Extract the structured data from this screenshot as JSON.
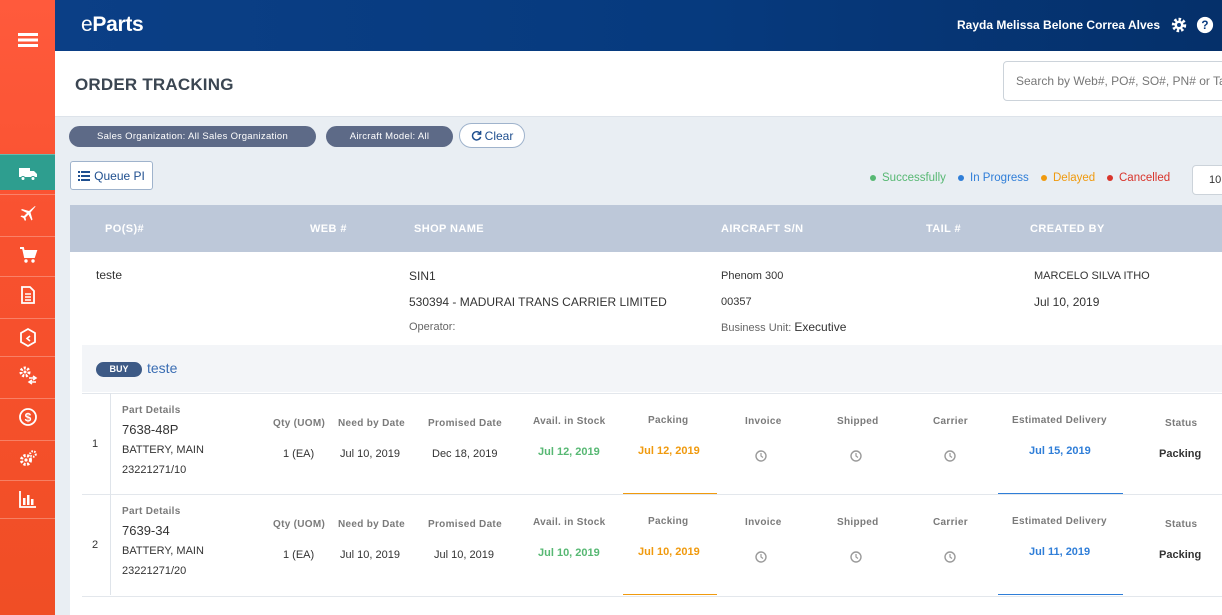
{
  "app": {
    "brand_e": "e",
    "brand_rest": "Parts",
    "user": "Rayda Melissa Belone Correa Alves"
  },
  "page": {
    "title": "ORDER TRACKING"
  },
  "search": {
    "placeholder": "Search by Web#, PO#, SO#, PN# or Tail#"
  },
  "filters": {
    "sales_org": "Sales Organization: All Sales Organization",
    "aircraft_model": "Aircraft Model: All",
    "clear": "Clear",
    "queue": "Queue PI"
  },
  "legend": [
    {
      "label": "Successfully",
      "color": "#57b873"
    },
    {
      "label": "In Progress",
      "color": "#2f7ed8"
    },
    {
      "label": "Delayed",
      "color": "#f09a0e"
    },
    {
      "label": "Cancelled",
      "color": "#d9342b"
    }
  ],
  "page_size": "10",
  "table": {
    "headers": [
      "PO(S)#",
      "WEB #",
      "SHOP NAME",
      "AIRCRAFT S/N",
      "TAIL #",
      "CREATED BY"
    ]
  },
  "order": {
    "po": "teste",
    "shop_name": "SIN1",
    "shop_detail": "530394 - MADURAI TRANS CARRIER LIMITED",
    "operator_label": "Operator:",
    "aircraft": "Phenom 300",
    "serial": "00357",
    "business_unit_label": "Business Unit:",
    "business_unit": "Executive",
    "created_by": "MARCELO SILVA ITHO",
    "created_date": "Jul 10, 2019",
    "type_badge": "BUY",
    "name": "teste"
  },
  "line_headers": {
    "part": "Part Details",
    "qty": "Qty (UOM)",
    "need_by": "Need by Date",
    "promised": "Promised Date",
    "avail": "Avail. in Stock",
    "packing": "Packing",
    "invoice": "Invoice",
    "shipped": "Shipped",
    "carrier": "Carrier",
    "est_delivery": "Estimated Delivery",
    "status": "Status"
  },
  "lines": [
    {
      "num": "1",
      "pn": "7638-48P",
      "desc": "BATTERY, MAIN",
      "ref": "23221271/10",
      "qty": "1 (EA)",
      "need_by": "Jul 10, 2019",
      "promised": "Dec 18, 2019",
      "avail": "Jul 12, 2019",
      "packing": "Jul 12, 2019",
      "est_delivery": "Jul 15, 2019",
      "status": "Packing"
    },
    {
      "num": "2",
      "pn": "7639-34",
      "desc": "BATTERY, MAIN",
      "ref": "23221271/20",
      "qty": "1 (EA)",
      "need_by": "Jul 10, 2019",
      "promised": "Jul 10, 2019",
      "avail": "Jul 10, 2019",
      "packing": "Jul 10, 2019",
      "est_delivery": "Jul 11, 2019",
      "status": "Packing"
    }
  ],
  "sidebar": {
    "icons": [
      "menu-icon",
      "truck-icon",
      "airplane-icon",
      "cart-icon",
      "document-icon",
      "box-return-icon",
      "gears-exchange-icon",
      "dollar-icon",
      "settings-icon",
      "bar-chart-icon"
    ]
  }
}
